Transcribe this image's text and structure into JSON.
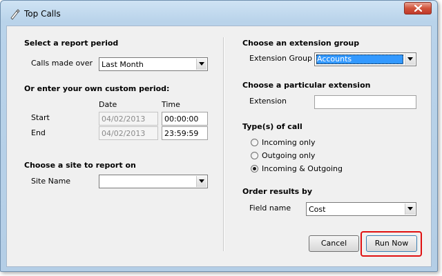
{
  "window": {
    "title": "Top Calls",
    "icon": "phone-handset-icon",
    "close_icon": "close-icon"
  },
  "left": {
    "report_period": {
      "heading": "Select a report period",
      "calls_made_over_label": "Calls made over",
      "calls_made_over_value": "Last Month"
    },
    "custom_period": {
      "heading": "Or enter your own custom period:",
      "date_header": "Date",
      "time_header": "Time",
      "start_label": "Start",
      "start_date": "04/02/2013",
      "start_time": "00:00:00",
      "end_label": "End",
      "end_date": "04/02/2013",
      "end_time": "23:59:59"
    },
    "site": {
      "heading": "Choose a site to report on",
      "site_name_label": "Site Name",
      "site_name_value": ""
    }
  },
  "right": {
    "extension_group": {
      "heading": "Choose an extension group",
      "label": "Extension Group",
      "value": "Accounts"
    },
    "extension": {
      "heading": "Choose a particular extension",
      "label": "Extension",
      "value": ""
    },
    "call_types": {
      "heading": "Type(s) of call",
      "options": [
        {
          "label": "Incoming only",
          "selected": false
        },
        {
          "label": "Outgoing only",
          "selected": false
        },
        {
          "label": "Incoming & Outgoing",
          "selected": true
        }
      ]
    },
    "order": {
      "heading": "Order results by",
      "field_label": "Field name",
      "field_value": "Cost"
    }
  },
  "buttons": {
    "cancel": "Cancel",
    "run_now": "Run Now"
  },
  "colors": {
    "highlight": "#e01010",
    "selection": "#3399ff"
  }
}
